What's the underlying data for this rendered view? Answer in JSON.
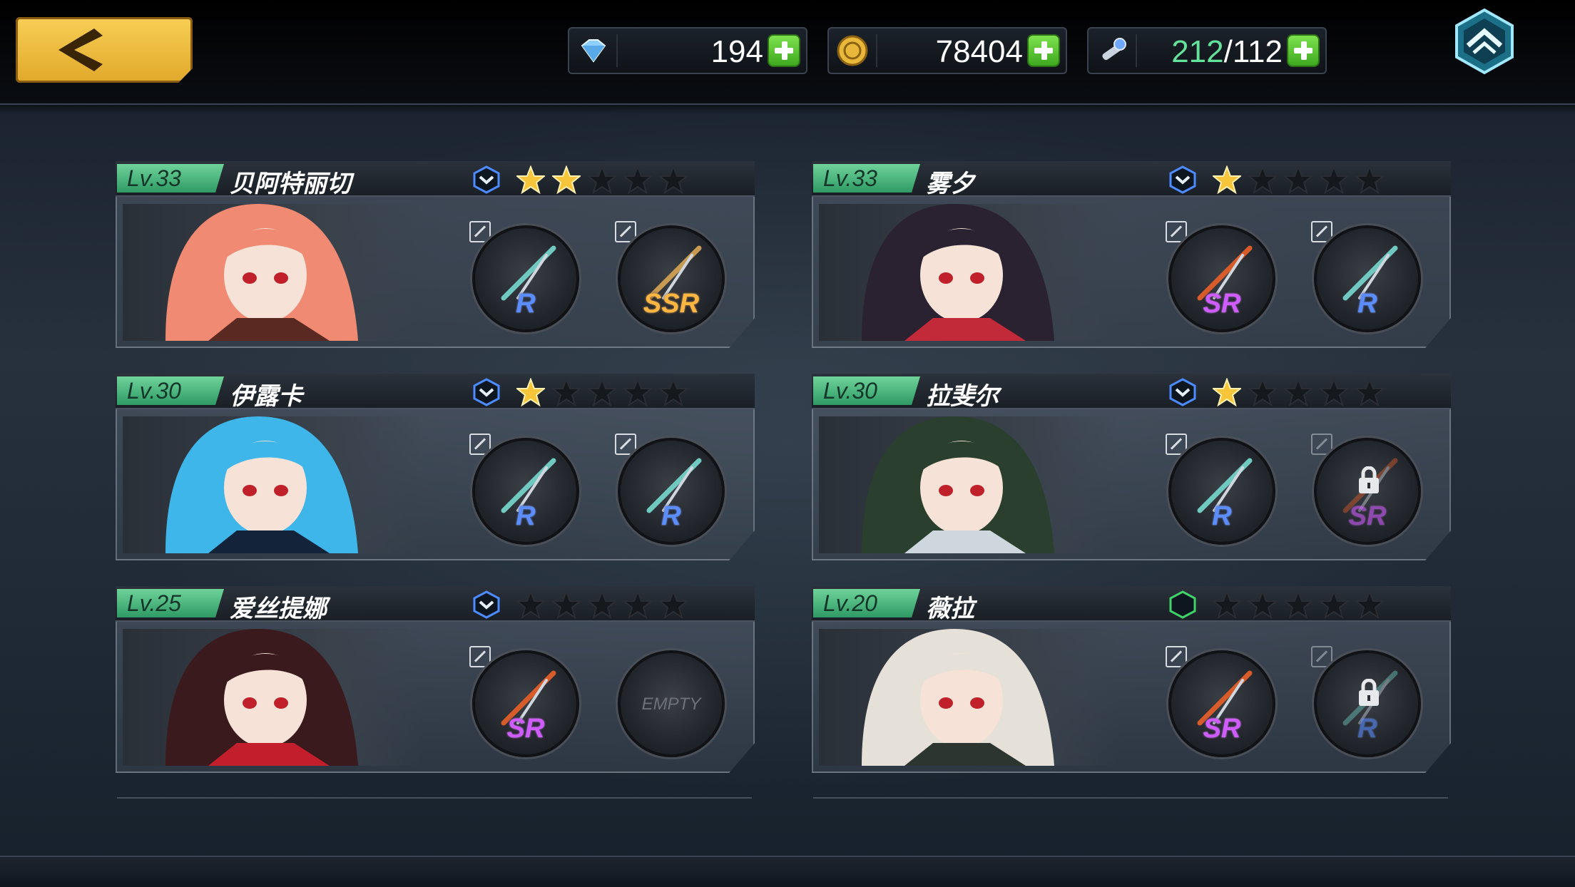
{
  "resources": {
    "gems": "194",
    "gold": "78404",
    "stamina_current": "212",
    "stamina_max": "/112"
  },
  "characters": [
    {
      "level": "Lv.33",
      "name": "贝阿特丽切",
      "stars": 2,
      "rank_color": "#4d8cff",
      "slots": [
        {
          "grade": "R",
          "type": "R"
        },
        {
          "grade": "SSR",
          "type": "SSR"
        }
      ]
    },
    {
      "level": "Lv.33",
      "name": "雾夕",
      "stars": 1,
      "rank_color": "#4d8cff",
      "slots": [
        {
          "grade": "SR",
          "type": "SR"
        },
        {
          "grade": "R",
          "type": "R"
        }
      ]
    },
    {
      "level": "Lv.30",
      "name": "伊露卡",
      "stars": 1,
      "rank_color": "#4d8cff",
      "slots": [
        {
          "grade": "R",
          "type": "R"
        },
        {
          "grade": "R",
          "type": "R"
        }
      ]
    },
    {
      "level": "Lv.30",
      "name": "拉斐尔",
      "stars": 1,
      "rank_color": "#4d8cff",
      "slots": [
        {
          "grade": "R",
          "type": "R"
        },
        {
          "grade": "SR",
          "type": "SR",
          "locked": true
        }
      ]
    },
    {
      "level": "Lv.25",
      "name": "爱丝提娜",
      "stars": 0,
      "rank_color": "#4d8cff",
      "slots": [
        {
          "grade": "SR",
          "type": "SR"
        },
        {
          "grade": "",
          "type": "EMPTY",
          "empty_label": "EMPTY"
        }
      ]
    },
    {
      "level": "Lv.20",
      "name": "薇拉",
      "stars": 0,
      "rank_color": "#3fd36a",
      "slots": [
        {
          "grade": "SR",
          "type": "SR"
        },
        {
          "grade": "R",
          "type": "R",
          "locked": true
        }
      ]
    }
  ]
}
